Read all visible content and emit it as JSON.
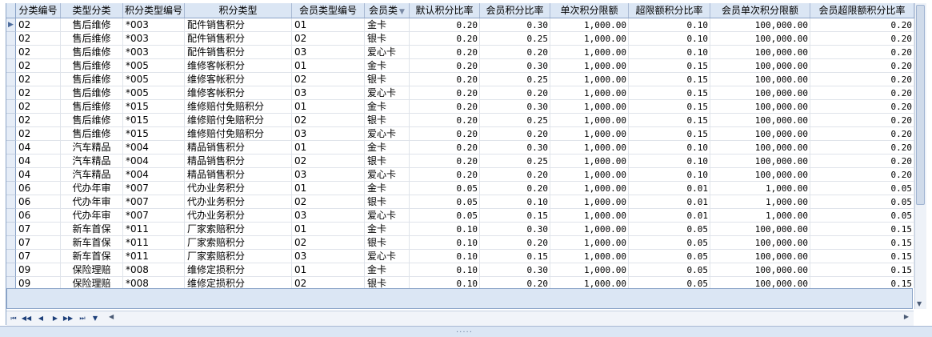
{
  "columns": [
    {
      "label": "分类编号",
      "w": 56,
      "align": "txt"
    },
    {
      "label": "类型分类",
      "w": 78,
      "align": "ctr"
    },
    {
      "label": "积分类型编号",
      "w": 77,
      "align": "txt"
    },
    {
      "label": "积分类型",
      "w": 134,
      "align": "txt"
    },
    {
      "label": "会员类型编号",
      "w": 91,
      "align": "txt"
    },
    {
      "label": "会员类",
      "w": 56,
      "align": "txt",
      "filter": true
    },
    {
      "label": "默认积分比率",
      "w": 88,
      "align": "num"
    },
    {
      "label": "会员积分比率",
      "w": 88,
      "align": "num"
    },
    {
      "label": "单次积分限额",
      "w": 98,
      "align": "num"
    },
    {
      "label": "超限额积分比率",
      "w": 102,
      "align": "num"
    },
    {
      "label": "会员单次积分限额",
      "w": 125,
      "align": "num"
    },
    {
      "label": "会员超限额积分比率",
      "w": 130,
      "align": "num"
    }
  ],
  "filter_icon": "filter-icon",
  "rows": [
    [
      "02",
      "售后维修",
      "*003",
      "配件销售积分",
      "01",
      "金卡",
      "0.20",
      "0.30",
      "1,000.00",
      "0.10",
      "100,000.00",
      "0.20"
    ],
    [
      "02",
      "售后维修",
      "*003",
      "配件销售积分",
      "02",
      "银卡",
      "0.20",
      "0.25",
      "1,000.00",
      "0.10",
      "100,000.00",
      "0.20"
    ],
    [
      "02",
      "售后维修",
      "*003",
      "配件销售积分",
      "03",
      "爱心卡",
      "0.20",
      "0.20",
      "1,000.00",
      "0.10",
      "100,000.00",
      "0.20"
    ],
    [
      "02",
      "售后维修",
      "*005",
      "维修客帐积分",
      "01",
      "金卡",
      "0.20",
      "0.30",
      "1,000.00",
      "0.15",
      "100,000.00",
      "0.20"
    ],
    [
      "02",
      "售后维修",
      "*005",
      "维修客帐积分",
      "02",
      "银卡",
      "0.20",
      "0.25",
      "1,000.00",
      "0.15",
      "100,000.00",
      "0.20"
    ],
    [
      "02",
      "售后维修",
      "*005",
      "维修客帐积分",
      "03",
      "爱心卡",
      "0.20",
      "0.20",
      "1,000.00",
      "0.15",
      "100,000.00",
      "0.20"
    ],
    [
      "02",
      "售后维修",
      "*015",
      "维修赔付免赔积分",
      "01",
      "金卡",
      "0.20",
      "0.30",
      "1,000.00",
      "0.15",
      "100,000.00",
      "0.20"
    ],
    [
      "02",
      "售后维修",
      "*015",
      "维修赔付免赔积分",
      "02",
      "银卡",
      "0.20",
      "0.25",
      "1,000.00",
      "0.15",
      "100,000.00",
      "0.20"
    ],
    [
      "02",
      "售后维修",
      "*015",
      "维修赔付免赔积分",
      "03",
      "爱心卡",
      "0.20",
      "0.20",
      "1,000.00",
      "0.15",
      "100,000.00",
      "0.20"
    ],
    [
      "04",
      "汽车精品",
      "*004",
      "精品销售积分",
      "01",
      "金卡",
      "0.20",
      "0.30",
      "1,000.00",
      "0.10",
      "100,000.00",
      "0.20"
    ],
    [
      "04",
      "汽车精品",
      "*004",
      "精品销售积分",
      "02",
      "银卡",
      "0.20",
      "0.25",
      "1,000.00",
      "0.10",
      "100,000.00",
      "0.20"
    ],
    [
      "04",
      "汽车精品",
      "*004",
      "精品销售积分",
      "03",
      "爱心卡",
      "0.20",
      "0.20",
      "1,000.00",
      "0.10",
      "100,000.00",
      "0.20"
    ],
    [
      "06",
      "代办年审",
      "*007",
      "代办业务积分",
      "01",
      "金卡",
      "0.05",
      "0.20",
      "1,000.00",
      "0.01",
      "1,000.00",
      "0.05"
    ],
    [
      "06",
      "代办年审",
      "*007",
      "代办业务积分",
      "02",
      "银卡",
      "0.05",
      "0.10",
      "1,000.00",
      "0.01",
      "1,000.00",
      "0.05"
    ],
    [
      "06",
      "代办年审",
      "*007",
      "代办业务积分",
      "03",
      "爱心卡",
      "0.05",
      "0.15",
      "1,000.00",
      "0.01",
      "1,000.00",
      "0.05"
    ],
    [
      "07",
      "新车首保",
      "*011",
      "厂家索赔积分",
      "01",
      "金卡",
      "0.10",
      "0.30",
      "1,000.00",
      "0.05",
      "100,000.00",
      "0.15"
    ],
    [
      "07",
      "新车首保",
      "*011",
      "厂家索赔积分",
      "02",
      "银卡",
      "0.10",
      "0.20",
      "1,000.00",
      "0.05",
      "100,000.00",
      "0.15"
    ],
    [
      "07",
      "新车首保",
      "*011",
      "厂家索赔积分",
      "03",
      "爱心卡",
      "0.10",
      "0.15",
      "1,000.00",
      "0.05",
      "100,000.00",
      "0.15"
    ],
    [
      "09",
      "保险理赔",
      "*008",
      "维修定损积分",
      "01",
      "金卡",
      "0.10",
      "0.30",
      "1,000.00",
      "0.05",
      "100,000.00",
      "0.15"
    ],
    [
      "09",
      "保险理赔",
      "*008",
      "维修定损积分",
      "02",
      "银卡",
      "0.10",
      "0.20",
      "1,000.00",
      "0.05",
      "100,000.00",
      "0.15"
    ]
  ],
  "nav": {
    "first": "⏮",
    "prev_page": "◀◀",
    "prev": "◀",
    "next": "▶",
    "next_page": "▶▶",
    "last": "⏭",
    "filter": "▼"
  },
  "current_row_marker": "▶",
  "grip": "....."
}
